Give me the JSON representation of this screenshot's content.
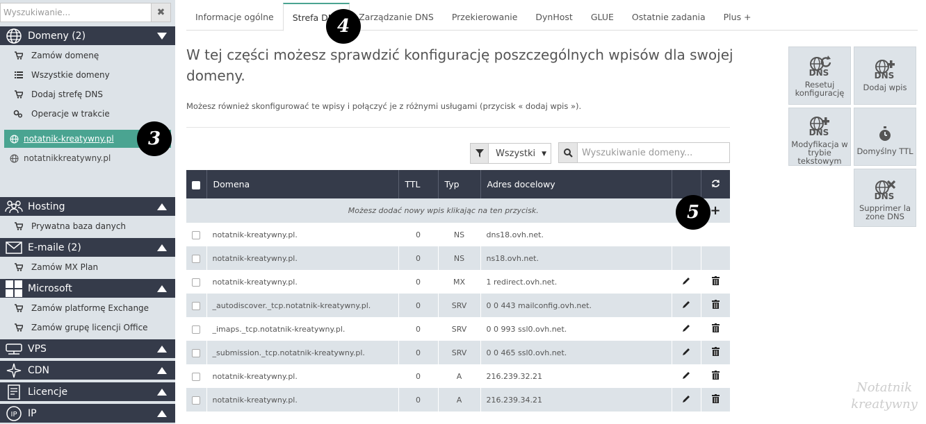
{
  "sidebar": {
    "search_placeholder": "Wyszukiwanie...",
    "sections": {
      "domeny": {
        "label": "Domeny (2)",
        "items": [
          "Zamów domenę",
          "Wszystkie domeny",
          "Dodaj strefę DNS",
          "Operacje w trakcie"
        ],
        "domains": [
          "notatnik-kreatywny.pl",
          "notatnikkreatywny.pl"
        ]
      },
      "hosting": {
        "label": "Hosting",
        "items": [
          "Prywatna baza danych"
        ]
      },
      "emaile": {
        "label": "E-maile (2)",
        "items": [
          "Zamów MX Plan"
        ]
      },
      "microsoft": {
        "label": "Microsoft",
        "items": [
          "Zamów platformę Exchange",
          "Zamów grupę licencji Office"
        ]
      },
      "vps": {
        "label": "VPS"
      },
      "cdn": {
        "label": "CDN"
      },
      "licencje": {
        "label": "Licencje"
      },
      "ip": {
        "label": "IP"
      }
    }
  },
  "badges": [
    "3",
    "4",
    "5"
  ],
  "tabs": [
    "Informacje ogólne",
    "Strefa DNS",
    "Zarządzanie DNS",
    "Przekierowanie",
    "DynHost",
    "GLUE",
    "Ostatnie zadania",
    "Plus +"
  ],
  "main": {
    "heading": "W tej części możesz sprawdzić konfigurację poszczególnych wpisów dla swojej domeny.",
    "subtext": "Możesz również skonfigurować te wpisy i połączyć je z różnymi usługami (przycisk « dodaj wpis »).",
    "filter_value": "Wszystki",
    "search_placeholder": "Wyszukiwanie domeny..."
  },
  "table": {
    "headers": [
      "Domena",
      "TTL",
      "Typ",
      "Adres docelowy"
    ],
    "add_row_text": "Możesz dodać nowy wpis klikając na ten przycisk.",
    "rows": [
      {
        "domain": "notatnik-kreatywny.pl.",
        "ttl": "0",
        "type": "NS",
        "target": "dns18.ovh.net."
      },
      {
        "domain": "notatnik-kreatywny.pl.",
        "ttl": "0",
        "type": "NS",
        "target": "ns18.ovh.net."
      },
      {
        "domain": "notatnik-kreatywny.pl.",
        "ttl": "0",
        "type": "MX",
        "target": "1 redirect.ovh.net."
      },
      {
        "domain": "_autodiscover._tcp.notatnik-kreatywny.pl.",
        "ttl": "0",
        "type": "SRV",
        "target": "0 0 443 mailconfig.ovh.net."
      },
      {
        "domain": "_imaps._tcp.notatnik-kreatywny.pl.",
        "ttl": "0",
        "type": "SRV",
        "target": "0 0 993 ssl0.ovh.net."
      },
      {
        "domain": "_submission._tcp.notatnik-kreatywny.pl.",
        "ttl": "0",
        "type": "SRV",
        "target": "0 0 465 ssl0.ovh.net."
      },
      {
        "domain": "notatnik-kreatywny.pl.",
        "ttl": "0",
        "type": "A",
        "target": "216.239.32.21"
      },
      {
        "domain": "notatnik-kreatywny.pl.",
        "ttl": "0",
        "type": "A",
        "target": "216.239.34.21"
      }
    ]
  },
  "actions": {
    "reset": "Resetuj konfigurację",
    "add": "Dodaj wpis",
    "text_edit": "Modyfikacja w trybie tekstowym",
    "ttl": "Domyślny TTL",
    "delete_zone": "Supprimer la zone DNS",
    "dns_icon_text": "DNS"
  },
  "watermark": [
    "Notatnik",
    "kreatywny"
  ],
  "colors": {
    "dark_header": "#353b4a",
    "accent_green": "#4aa491",
    "sidebar_bg": "#dde3e8"
  }
}
